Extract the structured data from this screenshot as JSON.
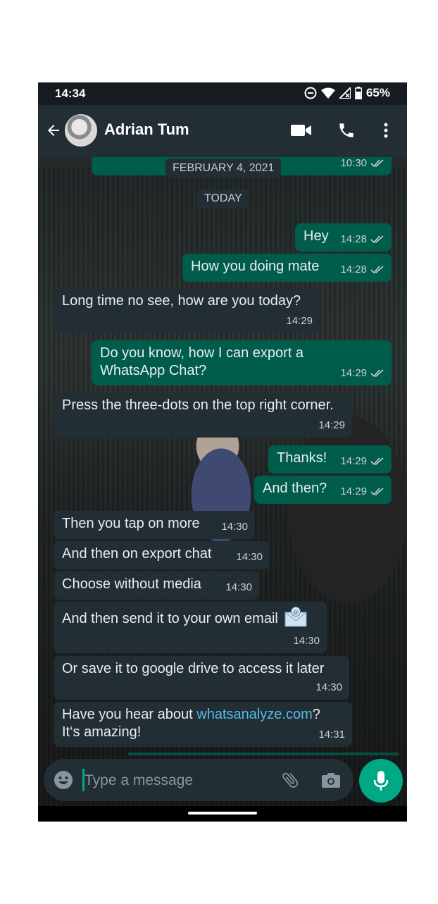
{
  "status": {
    "time": "14:34",
    "battery": "65%"
  },
  "header": {
    "contact_name": "Adrian Tum"
  },
  "partial_top_message": {
    "time": "10:30"
  },
  "date_chips": {
    "old": "FEBRUARY 4, 2021",
    "today": "TODAY"
  },
  "messages": [
    {
      "dir": "out",
      "text": "Hey",
      "time": "14:28"
    },
    {
      "dir": "out",
      "text": "How you doing mate",
      "time": "14:28"
    },
    {
      "dir": "in",
      "text": "Long time no see, how are you today?",
      "time": "14:29"
    },
    {
      "dir": "out",
      "text": "Do you know, how I can export a WhatsApp Chat?",
      "time": "14:29"
    },
    {
      "dir": "in",
      "text": "Press the three-dots on the top right corner.",
      "time": "14:29"
    },
    {
      "dir": "out",
      "text": "Thanks!",
      "time": "14:29"
    },
    {
      "dir": "out",
      "text": "And then?",
      "time": "14:29"
    },
    {
      "dir": "in",
      "text": "Then you tap on more",
      "time": "14:30"
    },
    {
      "dir": "in",
      "text": "And then on export chat",
      "time": "14:30"
    },
    {
      "dir": "in",
      "text": "Choose without media",
      "time": "14:30"
    },
    {
      "dir": "in",
      "text": "And then send it to your own email",
      "time": "14:30"
    },
    {
      "dir": "in",
      "text": "Or save it to google drive to access it later",
      "time": "14:30"
    },
    {
      "dir": "in",
      "text_before": "Have you hear about ",
      "link": "whatsanalyze.com",
      "text_after": "? It‘s amazing!",
      "time": "14:31"
    }
  ],
  "composer": {
    "placeholder": "Type a message"
  },
  "colors": {
    "incoming": "#222d34",
    "outgoing": "#005c4b",
    "accent": "#00a884",
    "link": "#53bdeb"
  },
  "icons": [
    "back-arrow-icon",
    "video-call-icon",
    "phone-icon",
    "more-vert-icon",
    "emoji-icon",
    "attach-icon",
    "camera-icon",
    "mic-icon",
    "double-check-icon",
    "email-emoji-icon",
    "wifi-icon",
    "signal-icon",
    "battery-icon",
    "dnd-icon"
  ]
}
